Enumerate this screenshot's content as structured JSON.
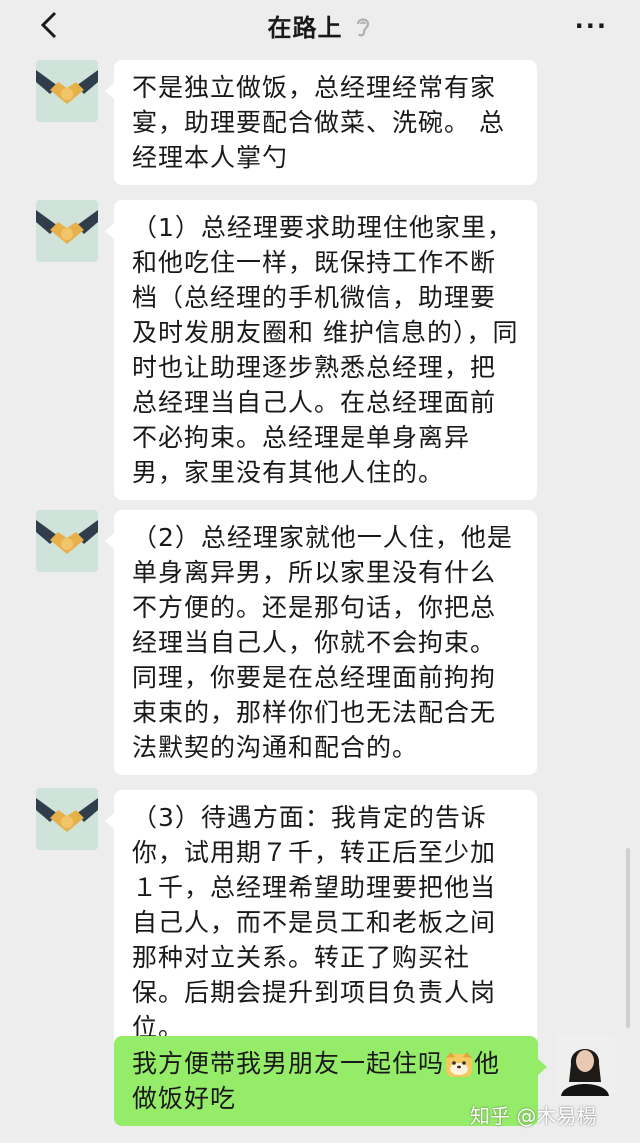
{
  "header": {
    "title": "在路上",
    "back_icon": "chevron-left-icon",
    "mute_icon": "ear-icon",
    "more_label": "···"
  },
  "messages": [
    {
      "sender": "other",
      "text": "不是独立做饭，总经理经常有家宴，助理要配合做菜、洗碗。 总经理本人掌勺"
    },
    {
      "sender": "other",
      "text": "（1）总经理要求助理住他家里，和他吃住一样，既保持工作不断档（总经理的手机微信，助理要及时发朋友圈和 维护信息的），同时也让助理逐步熟悉总经理，把总经理当自己人。在总经理面前不必拘束。总经理是单身离异男，家里没有其他人住的。"
    },
    {
      "sender": "other",
      "text": "（2）总经理家就他一人住，他是单身离异男，所以家里没有什么不方便的。还是那句话，你把总经理当自己人，你就不会拘束。同理，你要是在总经理面前拘拘束束的，那样你们也无法配合无法默契的沟通和配合的。"
    },
    {
      "sender": "other",
      "text": "（3）待遇方面：我肯定的告诉你，试用期７千，转正后至少加１千，总经理希望助理要把他当自己人，而不是员工和老板之间那种对立关系。转正了购买社保。后期会提升到项目负责人岗位。"
    },
    {
      "sender": "self",
      "text_before": "我方便带我男朋友一起住吗",
      "emoji": "dog-face-emoji",
      "text_after": "他做饭好吃"
    }
  ],
  "watermark": "知乎 @木易楊",
  "colors": {
    "background": "#ededed",
    "incoming_bubble": "#ffffff",
    "outgoing_bubble": "#95ec69"
  }
}
